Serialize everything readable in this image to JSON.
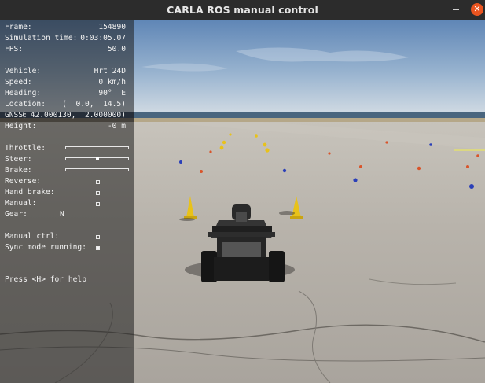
{
  "window": {
    "title": "CARLA ROS manual control"
  },
  "hud": {
    "frame": {
      "label": "Frame:",
      "value": "154890"
    },
    "sim_time": {
      "label": "Simulation time:",
      "value": "0:03:05.07"
    },
    "fps": {
      "label": "FPS:",
      "value": "50.0"
    },
    "vehicle": {
      "label": "Vehicle:",
      "value": "Hrt 24D"
    },
    "speed": {
      "label": "Speed:",
      "value": "0 km/h"
    },
    "heading": {
      "label": "Heading:",
      "value": "90°  E"
    },
    "location": {
      "label": "Location:",
      "value": "(  0.0,  14.5)"
    },
    "gnss": {
      "label": "GNSS:",
      "value": "( 42.000130,  2.000000)"
    },
    "height": {
      "label": "Height:",
      "value": "-0 m"
    },
    "throttle": {
      "label": "Throttle:",
      "level": 0.0
    },
    "steer": {
      "label": "Steer:",
      "level": 0.5
    },
    "brake": {
      "label": "Brake:",
      "level": 0.0
    },
    "reverse": {
      "label": "Reverse:",
      "checked": false
    },
    "hand_brake": {
      "label": "Hand brake:",
      "checked": false
    },
    "manual": {
      "label": "Manual:",
      "checked": false
    },
    "gear": {
      "label": "Gear:",
      "value": "N"
    },
    "manual_ctrl": {
      "label": "Manual ctrl:",
      "checked": false
    },
    "sync_mode": {
      "label": "Sync mode running:",
      "checked": true
    },
    "help": "Press <H> for help"
  },
  "colors": {
    "sky_top": "#6f93bd",
    "sky_horizon": "#c9d6e3",
    "ground": "#b9b4ae",
    "cone_yellow": "#e8c21a",
    "cone_blue": "#2a3fb8",
    "cone_orange": "#d9542a",
    "close_button": "#e95420"
  },
  "icons": {
    "minimize": "minimize-icon",
    "close": "close-icon"
  }
}
